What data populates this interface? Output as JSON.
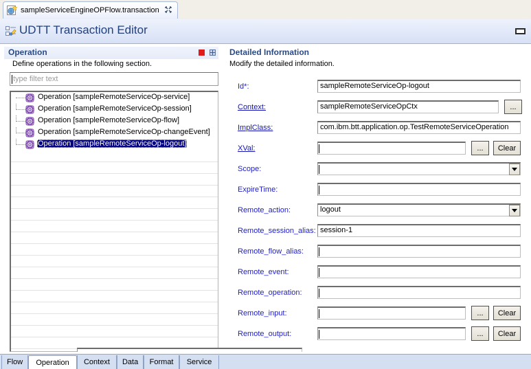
{
  "window": {
    "editor_tab_label": "sampleServiceEngineOPFlow.transaction",
    "editor_tab_close": "✂",
    "form_title": "UDTT Transaction Editor",
    "minimize_label": ""
  },
  "left": {
    "section_title": "Operation",
    "section_description": "Define operations in the following section.",
    "filter_placeholder": "type filter text",
    "filter_value": "",
    "tools": {
      "red": "error-marker",
      "blue": "maximize-section"
    },
    "tree_items": [
      {
        "label": "Operation [sampleRemoteServiceOp-service]",
        "selected": false
      },
      {
        "label": "Operation [sampleRemoteServiceOp-session]",
        "selected": false
      },
      {
        "label": "Operation [sampleRemoteServiceOp-flow]",
        "selected": false
      },
      {
        "label": "Operation [sampleRemoteServiceOp-changeEvent]",
        "selected": false
      },
      {
        "label": "Operation [sampleRemoteServiceOp-logout]",
        "selected": true
      }
    ],
    "empty_row_count": 17
  },
  "right": {
    "section_title": "Detailed Information",
    "section_description": "Modify the detailed information.",
    "browse_label": "...",
    "clear_label": "Clear",
    "fields": [
      {
        "label": "Id*:",
        "link": false,
        "value": "sampleRemoteServiceOp-logout",
        "type": "text",
        "browse": false,
        "clear": false
      },
      {
        "label": "Context:",
        "link": true,
        "value": "sampleRemoteServiceOpCtx",
        "type": "text",
        "browse": true,
        "clear": false
      },
      {
        "label": "ImplClass:",
        "link": true,
        "value": "com.ibm.btt.application.op.TestRemoteServiceOperation",
        "type": "text",
        "browse": false,
        "clear": false
      },
      {
        "label": "XVal:",
        "link": true,
        "value": "",
        "type": "text",
        "browse": true,
        "clear": true
      },
      {
        "label": "Scope:",
        "link": false,
        "value": "",
        "type": "combo",
        "browse": false,
        "clear": false
      },
      {
        "label": "ExpireTime:",
        "link": false,
        "value": "",
        "type": "text",
        "browse": false,
        "clear": false
      },
      {
        "label": "Remote_action:",
        "link": false,
        "value": "logout",
        "type": "combo",
        "browse": false,
        "clear": false
      },
      {
        "label": "Remote_session_alias:",
        "link": false,
        "value": "session-1",
        "type": "text",
        "browse": false,
        "clear": false
      },
      {
        "label": "Remote_flow_alias:",
        "link": false,
        "value": "",
        "type": "text",
        "browse": false,
        "clear": false
      },
      {
        "label": "Remote_event:",
        "link": false,
        "value": "",
        "type": "text",
        "browse": false,
        "clear": false
      },
      {
        "label": "Remote_operation:",
        "link": false,
        "value": "",
        "type": "text",
        "browse": false,
        "clear": false
      },
      {
        "label": "Remote_input:",
        "link": false,
        "value": "",
        "type": "text",
        "browse": true,
        "clear": true
      },
      {
        "label": "Remote_output:",
        "link": false,
        "value": "",
        "type": "text",
        "browse": true,
        "clear": true
      }
    ]
  },
  "bottom_tabs": [
    {
      "label": "Flow",
      "active": false
    },
    {
      "label": "Operation",
      "active": true
    },
    {
      "label": "Context",
      "active": false
    },
    {
      "label": "Data",
      "active": false
    },
    {
      "label": "Format",
      "active": false
    },
    {
      "label": "Service",
      "active": false
    }
  ],
  "colors": {
    "section_title": "#2a4a86",
    "field_label": "#2020cc",
    "selection": "#000080",
    "error_marker": "#e01b1b",
    "form_title": "#23417c"
  }
}
